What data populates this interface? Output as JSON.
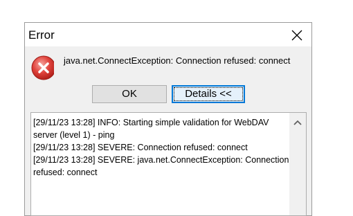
{
  "window": {
    "title": "Error"
  },
  "message": "java.net.ConnectException: Connection refused: connect",
  "buttons": {
    "ok_label": "OK",
    "details_label": "Details <<"
  },
  "details": {
    "lines": [
      "[29/11/23 13:28] INFO: Starting simple validation for WebDAV server (level 1) - ping",
      "[29/11/23 13:28] SEVERE: Connection refused: connect",
      "[29/11/23 13:28] SEVERE: java.net.ConnectException: Connection refused: connect"
    ]
  },
  "icons": {
    "close": "close-icon",
    "error": "error-icon",
    "scroll_up": "chevron-up-icon"
  },
  "colors": {
    "error_red": "#e0433c",
    "focus_blue": "#0078d7"
  }
}
